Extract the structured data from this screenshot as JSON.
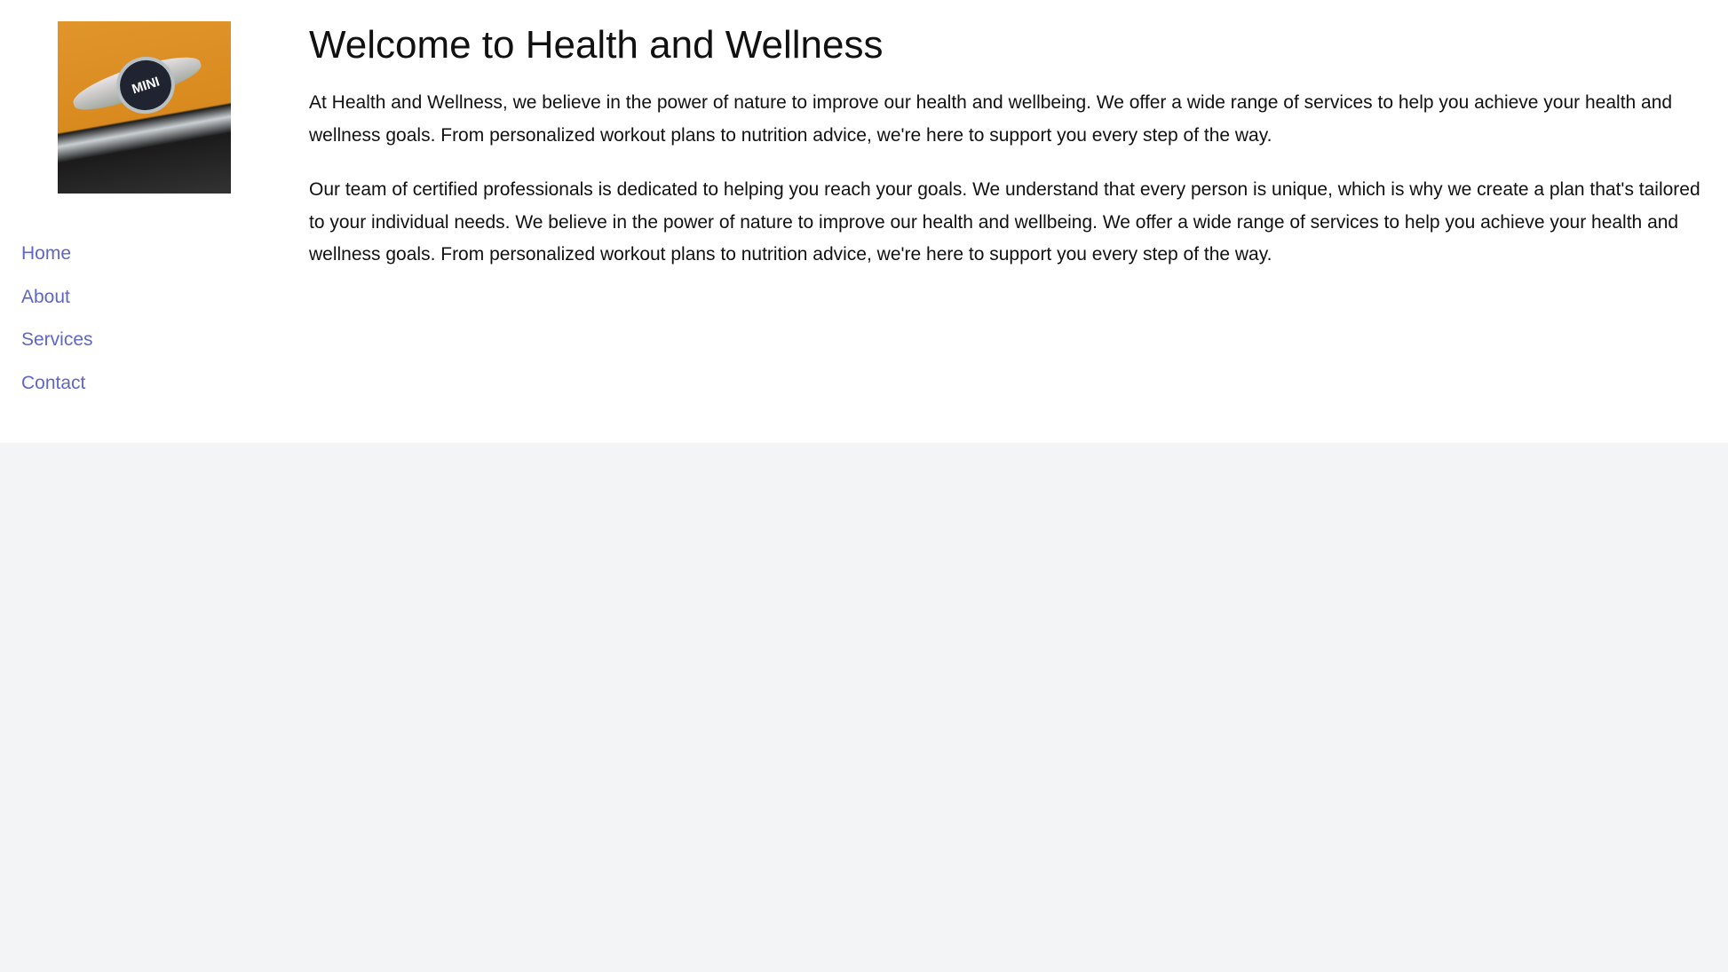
{
  "sidebar": {
    "logo_alt": "MINI car badge",
    "logo_badge_text": "MINI",
    "nav": [
      {
        "label": "Home"
      },
      {
        "label": "About"
      },
      {
        "label": "Services"
      },
      {
        "label": "Contact"
      }
    ]
  },
  "main": {
    "title": "Welcome to Health and Wellness",
    "paragraphs": [
      "At Health and Wellness, we believe in the power of nature to improve our health and wellbeing. We offer a wide range of services to help you achieve your health and wellness goals. From personalized workout plans to nutrition advice, we're here to support you every step of the way.",
      "Our team of certified professionals is dedicated to helping you reach your goals. We understand that every person is unique, which is why we create a plan that's tailored to your individual needs. We believe in the power of nature to improve our health and wellbeing. We offer a wide range of services to help you achieve your health and wellness goals. From personalized workout plans to nutrition advice, we're here to support you every step of the way."
    ]
  },
  "colors": {
    "link": "#5f67c4",
    "page_background": "#f3f4f6",
    "panel_background": "#ffffff"
  }
}
